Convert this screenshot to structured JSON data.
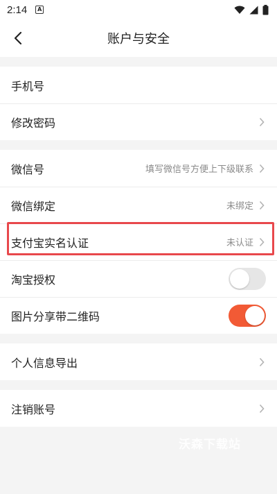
{
  "status_bar": {
    "time": "2:14",
    "notification_icon": "A",
    "icons": [
      "wifi-icon",
      "signal-icon",
      "battery-icon"
    ]
  },
  "header": {
    "title": "账户与安全",
    "back_icon": "chevron-left-icon"
  },
  "groups": [
    {
      "rows": [
        {
          "label": "手机号",
          "value": "",
          "chevron": false
        },
        {
          "label": "修改密码",
          "value": "",
          "chevron": true
        }
      ]
    },
    {
      "rows": [
        {
          "label": "微信号",
          "value": "填写微信号方便上下级联系",
          "chevron": true
        },
        {
          "label": "微信绑定",
          "value": "未绑定",
          "chevron": true
        },
        {
          "label": "支付宝实名认证",
          "value": "未认证",
          "chevron": true
        },
        {
          "label": "淘宝授权",
          "toggle": false
        },
        {
          "label": "图片分享带二维码",
          "toggle": true
        }
      ]
    },
    {
      "rows": [
        {
          "label": "个人信息导出",
          "value": "",
          "chevron": true
        }
      ]
    },
    {
      "rows": [
        {
          "label": "注销账号",
          "value": "",
          "chevron": true
        }
      ]
    }
  ],
  "colors": {
    "accent": "#f25a35",
    "highlight_border": "#e8484c",
    "background": "#f4f4f4"
  },
  "watermark": "沃森下载站"
}
